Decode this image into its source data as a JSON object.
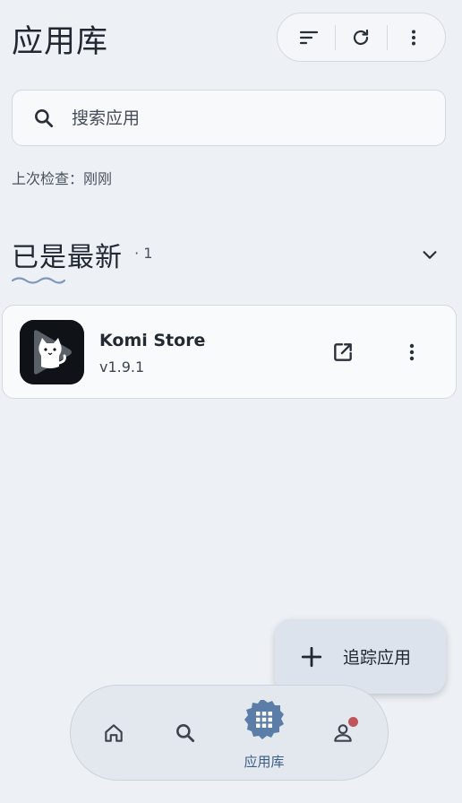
{
  "header": {
    "title": "应用库"
  },
  "toolbar": {
    "sort_icon": "sort-icon",
    "refresh_icon": "refresh-icon",
    "more_icon": "more-vert-icon"
  },
  "search": {
    "placeholder": "搜索应用",
    "value": ""
  },
  "status": {
    "last_check": "上次检查：刚刚"
  },
  "section": {
    "title": "已是最新",
    "count": "· 1"
  },
  "apps": [
    {
      "name": "Komi Store",
      "version": "v1.9.1",
      "icon": "komi-store-cat-play-icon"
    }
  ],
  "fab": {
    "label": "追踪应用",
    "icon": "plus-icon"
  },
  "nav": {
    "items": [
      {
        "id": "home",
        "icon": "home-icon"
      },
      {
        "id": "search",
        "icon": "search-icon"
      },
      {
        "id": "library",
        "icon": "grid-icon",
        "label": "应用库",
        "active": true
      },
      {
        "id": "profile",
        "icon": "person-icon",
        "badge": true
      }
    ]
  },
  "colors": {
    "background": "#edf0f5",
    "accent": "#3a5d85",
    "active_blob": "#5b7ea8",
    "badge": "#c0545a",
    "wave": "#7f98bb"
  }
}
